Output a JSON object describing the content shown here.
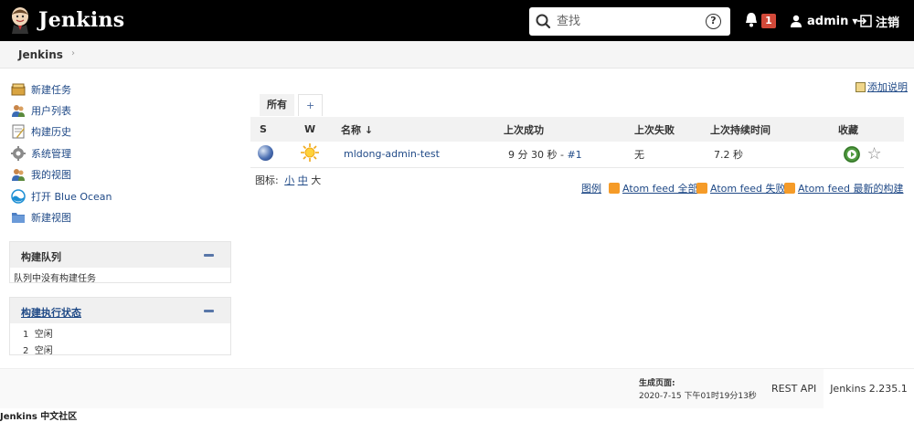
{
  "header": {
    "app_name": "Jenkins",
    "search_placeholder": "查找",
    "help_symbol": "?",
    "notification_count": "1",
    "user_name": "admin",
    "logout_label": "注销"
  },
  "breadcrumb": {
    "root": "Jenkins",
    "arrow": "›"
  },
  "sidebar": {
    "tasks": [
      {
        "label": "新建任务",
        "icon": "new-item-icon"
      },
      {
        "label": "用户列表",
        "icon": "users-icon"
      },
      {
        "label": "构建历史",
        "icon": "build-history-icon"
      },
      {
        "label": "系统管理",
        "icon": "gear-icon"
      },
      {
        "label": "我的视图",
        "icon": "my-views-icon"
      },
      {
        "label": "打开 Blue Ocean",
        "icon": "blue-ocean-icon"
      },
      {
        "label": "新建视图",
        "icon": "folder-icon"
      }
    ],
    "build_queue": {
      "title": "构建队列",
      "empty_text": "队列中没有构建任务"
    },
    "executors": {
      "title": "构建执行状态",
      "rows": [
        {
          "num": "1",
          "status": "空闲"
        },
        {
          "num": "2",
          "status": "空闲"
        }
      ]
    }
  },
  "main": {
    "add_description": "添加说明",
    "tabs": [
      {
        "label": "所有"
      },
      {
        "label": "+"
      }
    ],
    "table": {
      "headers": {
        "s": "S",
        "w": "W",
        "name": "名称 ↓",
        "last_success": "上次成功",
        "last_failure": "上次失败",
        "last_duration": "上次持续时间",
        "favorite": "收藏"
      },
      "rows": [
        {
          "name": "mldong-admin-test",
          "last_success_time": "9 分 30 秒 - ",
          "last_success_build": "#1",
          "last_failure": "无",
          "last_duration": "7.2 秒",
          "status_color": "blue",
          "weather": "sunny"
        }
      ]
    },
    "icon_size": {
      "label": "图标: ",
      "small": "小",
      "medium": "中",
      "large": "大"
    },
    "feeds": {
      "legend": "图例",
      "all": "Atom feed 全部",
      "failures": "Atom feed 失败",
      "latest": "Atom feed 最新的构建"
    }
  },
  "footer": {
    "generated_label": "生成页面:",
    "generated_time": "2020-7-15 下午01时19分13秒",
    "rest_api": "REST API",
    "version": "Jenkins 2.235.1"
  },
  "bottom_text": "Jenkins 中文社区"
}
